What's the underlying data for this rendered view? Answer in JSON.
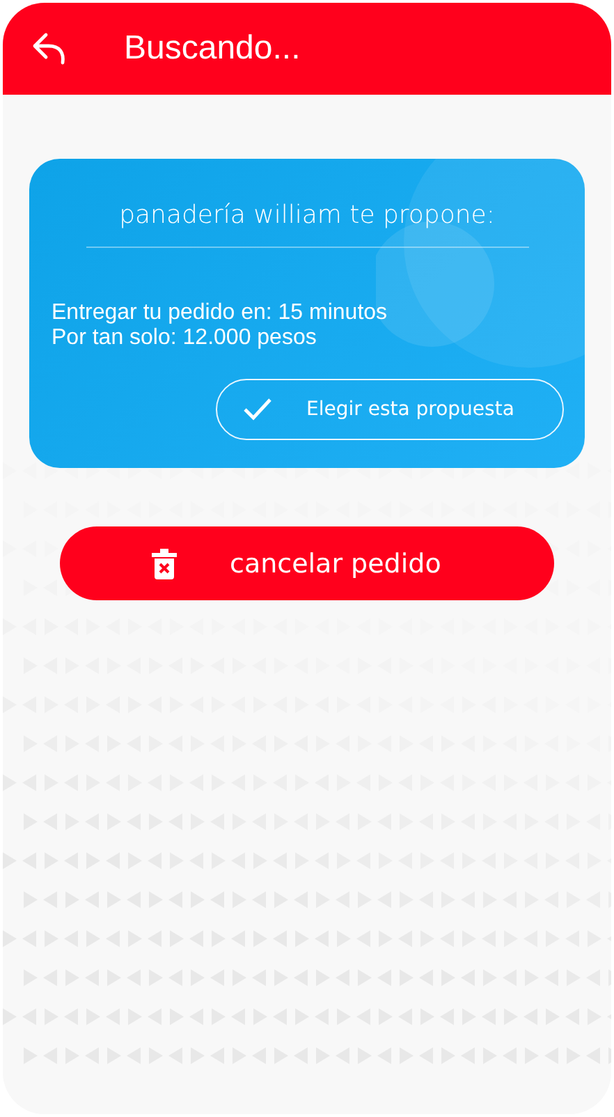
{
  "header": {
    "title": "Buscando..."
  },
  "proposal": {
    "title": "panadería william te propone:",
    "lines": [
      "Entregar tu pedido en: 15 minutos",
      "Por tan solo: 12.000 pesos"
    ],
    "action": "Elegir esta propuesta"
  },
  "cancel_button": "cancelar pedido"
}
